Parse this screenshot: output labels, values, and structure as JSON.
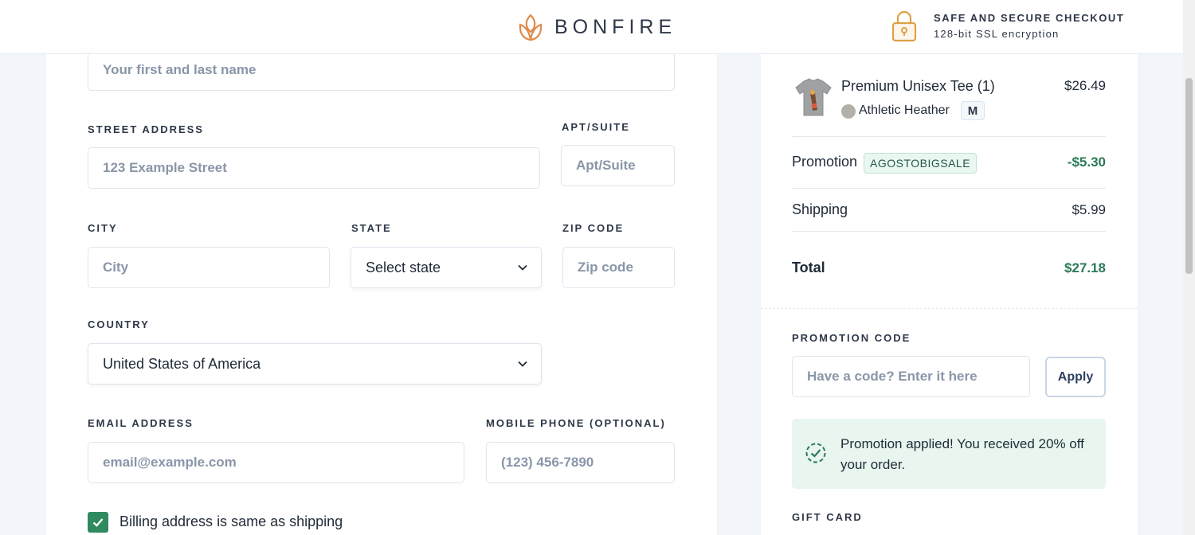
{
  "header": {
    "brand": "BONFIRE",
    "secure_title": "SAFE AND SECURE CHECKOUT",
    "secure_subtitle": "128-bit SSL encryption"
  },
  "form": {
    "name_placeholder": "Your first and last name",
    "street_label": "STREET ADDRESS",
    "street_placeholder": "123 Example Street",
    "apt_label": "APT/SUITE",
    "apt_placeholder": "Apt/Suite",
    "city_label": "CITY",
    "city_placeholder": "City",
    "state_label": "STATE",
    "state_value": "Select state",
    "zip_label": "ZIP CODE",
    "zip_placeholder": "Zip code",
    "country_label": "COUNTRY",
    "country_value": "United States of America",
    "email_label": "EMAIL ADDRESS",
    "email_placeholder": "email@example.com",
    "phone_label": "MOBILE PHONE (OPTIONAL)",
    "phone_placeholder": "(123) 456-7890",
    "billing_same_label": "Billing address is same as shipping",
    "billing_same_checked": true
  },
  "summary": {
    "item": {
      "name": "Premium Unisex Tee (1)",
      "price": "$26.49",
      "color": "Athletic Heather",
      "size": "M"
    },
    "promotion_label": "Promotion",
    "promotion_code": "AGOSTOBIGSALE",
    "promotion_value": "-$5.30",
    "shipping_label": "Shipping",
    "shipping_value": "$5.99",
    "total_label": "Total",
    "total_value": "$27.18",
    "promo_code_label": "PROMOTION CODE",
    "promo_code_placeholder": "Have a code? Enter it here",
    "apply_label": "Apply",
    "promo_applied_message": "Promotion applied! You received 20% off your order.",
    "gift_card_label": "GIFT CARD"
  },
  "colors": {
    "accent_green": "#2b7a56",
    "checkbox_green": "#2f8a5f",
    "logo_orange": "#e08b4c",
    "promo_bg": "#e8f6ef"
  }
}
